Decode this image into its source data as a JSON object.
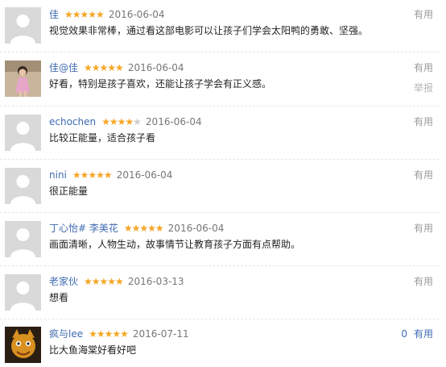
{
  "comments": [
    {
      "user": "佳",
      "rating": 5,
      "date": "2016-06-04",
      "text": "视觉效果非常棒，通过看这部电影可以让孩子们学会太阳鸭的勇敢、坚强。",
      "useful_label": "有用",
      "avatar": "default-avatar"
    },
    {
      "user": "佳@佳",
      "rating": 5,
      "date": "2016-06-04",
      "text": "好看，特别是孩子喜欢，还能让孩子学会有正义感。",
      "useful_label": "有用",
      "report_label": "举报",
      "avatar": "photo-avatar-girl"
    },
    {
      "user": "echochen",
      "rating": 4,
      "date": "2016-06-04",
      "text": "比较正能量，适合孩子看",
      "useful_label": "有用",
      "avatar": "default-avatar"
    },
    {
      "user": "nini",
      "rating": 5,
      "date": "2016-06-04",
      "text": "很正能量",
      "useful_label": "有用",
      "avatar": "default-avatar"
    },
    {
      "user": "丁心怡# 李美花",
      "rating": 5,
      "date": "2016-06-04",
      "text": "画面清晰，人物生动，故事情节让教育孩子方面有点帮助。",
      "useful_label": "有用",
      "avatar": "default-avatar"
    },
    {
      "user": "老家伙",
      "rating": 5,
      "date": "2016-03-13",
      "text": "想看",
      "useful_label": "有用",
      "avatar": "default-avatar"
    },
    {
      "user": "疯与lee",
      "rating": 5,
      "date": "2016-07-11",
      "text": "比大鱼海棠好看好吧",
      "useful_count": "0",
      "useful_label": "有用",
      "avatar": "photo-avatar-cartoon"
    }
  ],
  "colors": {
    "star": "#f5a623",
    "link": "#3f6bb2"
  }
}
